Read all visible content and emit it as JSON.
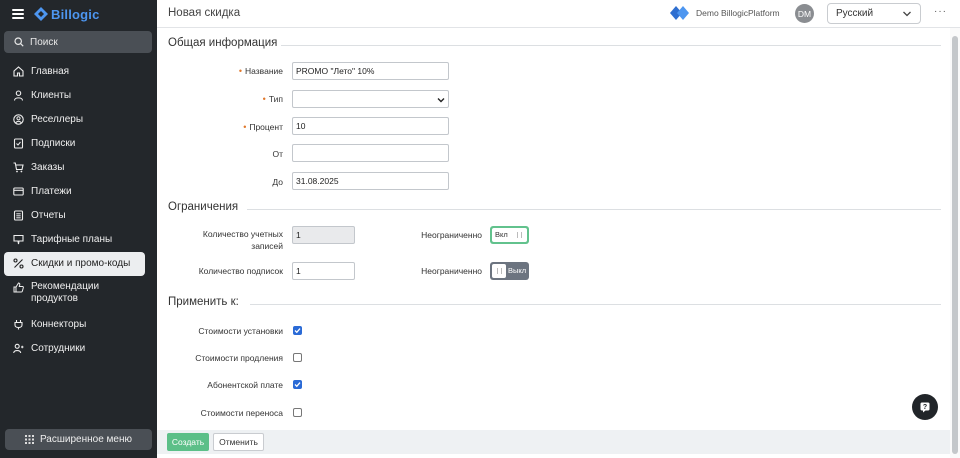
{
  "app": {
    "brand": "Billogic"
  },
  "sidebar": {
    "search_label": "Поиск",
    "items": [
      {
        "label": "Главная",
        "icon": "home-icon"
      },
      {
        "label": "Клиенты",
        "icon": "user-icon"
      },
      {
        "label": "Реселлеры",
        "icon": "user-circle-icon"
      },
      {
        "label": "Подписки",
        "icon": "subscription-icon"
      },
      {
        "label": "Заказы",
        "icon": "cart-icon"
      },
      {
        "label": "Платежи",
        "icon": "card-icon"
      },
      {
        "label": "Отчеты",
        "icon": "report-icon"
      },
      {
        "label": "Тарифные планы",
        "icon": "plans-icon"
      },
      {
        "label": "Скидки и промо-коды",
        "icon": "percent-icon",
        "active": true
      },
      {
        "label_line1": "Рекомендации",
        "label_line2": "продуктов",
        "icon": "thumbs-up-icon"
      },
      {
        "label": "Коннекторы",
        "icon": "connector-icon"
      },
      {
        "label": "Сотрудники",
        "icon": "staff-icon"
      }
    ],
    "extended_menu_label": "Расширенное меню"
  },
  "header": {
    "page_title": "Новая скидка",
    "platform": "Demo BillogicPlatform",
    "avatar_initials": "DM",
    "language": "Русский",
    "more": "···"
  },
  "general": {
    "title": "Общая информация",
    "name_label": "Название",
    "name_value": "PROMO \"Лето\" 10%",
    "type_label": "Тип",
    "type_value": "",
    "percent_label": "Процент",
    "percent_value": "10",
    "from_label": "От",
    "from_value": "",
    "to_label": "До",
    "to_value": "31.08.2025"
  },
  "limits": {
    "title": "Ограничения",
    "accounts_label_line1": "Количество учетных",
    "accounts_label_line2": "записей",
    "accounts_value": "1",
    "subscriptions_label": "Количество подписок",
    "subscriptions_value": "1",
    "unlimited_label": "Неограниченно",
    "toggle_on_label": "Вкл",
    "toggle_off_label": "Выкл"
  },
  "apply": {
    "title": "Применить к:",
    "options": [
      {
        "label": "Стоимости установки",
        "checked": true
      },
      {
        "label": "Стоимости продления",
        "checked": false
      },
      {
        "label": "Абонентской плате",
        "checked": true
      },
      {
        "label": "Стоимости переноса",
        "checked": false
      }
    ]
  },
  "footer": {
    "create_label": "Создать",
    "cancel_label": "Отменить"
  },
  "colors": {
    "sidebar_bg": "#23272b",
    "brand": "#4d96f0",
    "create_button": "#5cbf88",
    "toggle_on": "#62c28d",
    "toggle_off": "#6c7480",
    "checkbox_checked": "#2a6ad6",
    "required_marker": "#e0782b"
  }
}
